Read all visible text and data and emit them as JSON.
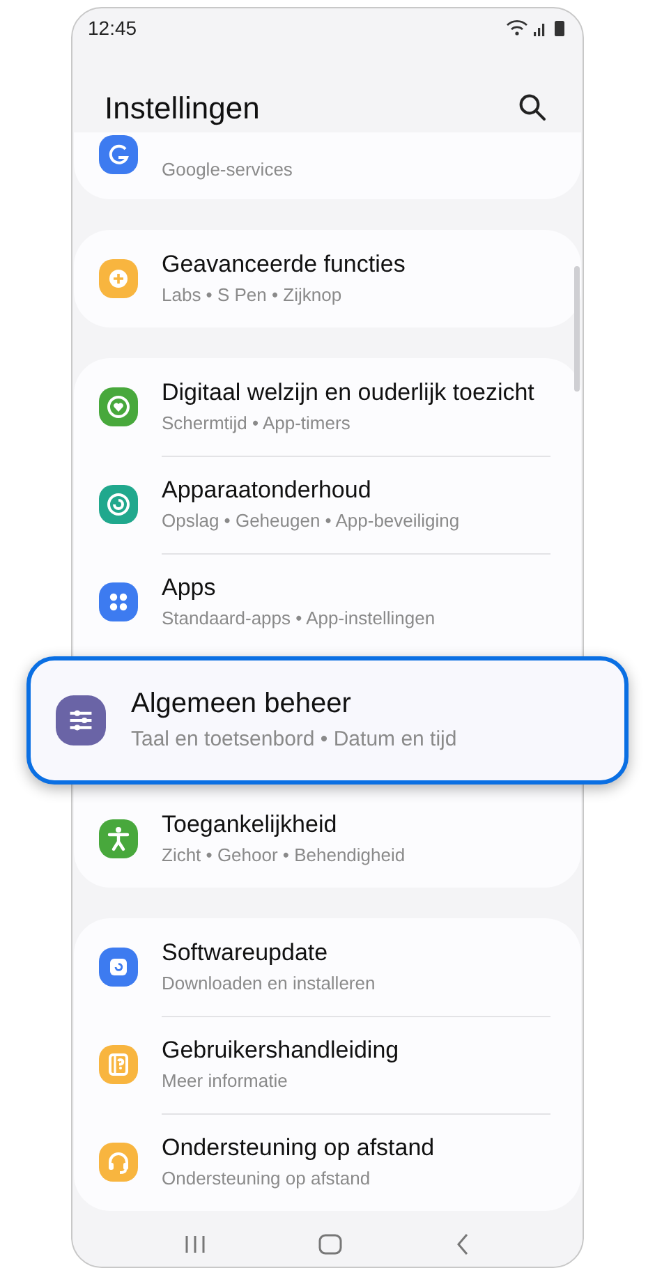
{
  "status_bar": {
    "time": "12:45"
  },
  "header": {
    "title": "Instellingen"
  },
  "groups": [
    {
      "items": [
        {
          "kind": "google",
          "color": "#3d7bf0",
          "subtitle": "Google-services",
          "selected": false
        }
      ]
    },
    {
      "items": [
        {
          "kind": "features",
          "color": "#f8b53f",
          "title": "Geavanceerde functies",
          "subtitle": "Labs • S Pen • Zijknop",
          "selected": false
        }
      ]
    },
    {
      "items": [
        {
          "kind": "wellbeing",
          "color": "#48a83c",
          "title": "Digitaal welzijn en ouderlijk toezicht",
          "subtitle": "Schermtijd • App-timers",
          "selected": false
        },
        {
          "kind": "care",
          "color": "#20a88d",
          "title": "Apparaatonderhoud",
          "subtitle": "Opslag • Geheugen • App-beveiliging",
          "selected": false
        },
        {
          "kind": "apps",
          "color": "#3d7bf0",
          "title": "Apps",
          "subtitle": "Standaard-apps • App-instellingen",
          "selected": false
        },
        {
          "kind": "general",
          "color": "#6a64a6",
          "title": "Algemeen beheer",
          "subtitle": "Taal en toetsenbord • Datum en tijd",
          "selected": true
        },
        {
          "kind": "accessibility",
          "color": "#48a83c",
          "title": "Toegankelijkheid",
          "subtitle": "Zicht • Gehoor • Behendigheid",
          "selected": false
        }
      ]
    },
    {
      "items": [
        {
          "kind": "update",
          "color": "#3d7bf0",
          "title": "Softwareupdate",
          "subtitle": "Downloaden en installeren",
          "selected": false
        },
        {
          "kind": "manual",
          "color": "#f8b53f",
          "title": "Gebruikershandleiding",
          "subtitle": "Meer informatie",
          "selected": false
        },
        {
          "kind": "support",
          "color": "#f8b53f",
          "title": "Ondersteuning op afstand",
          "subtitle": "Ondersteuning op afstand",
          "selected": false
        }
      ]
    }
  ]
}
